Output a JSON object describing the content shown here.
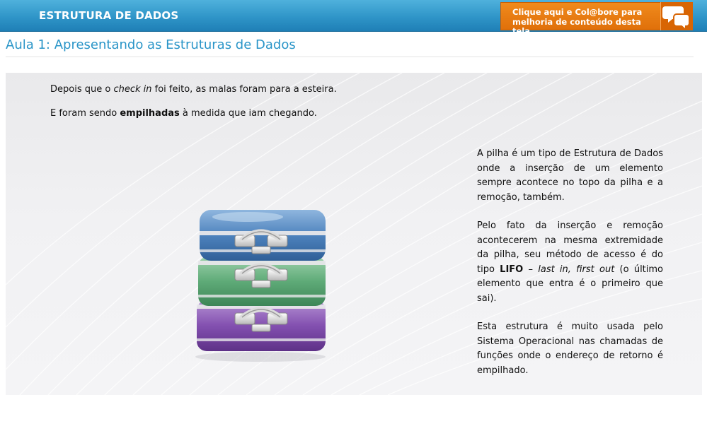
{
  "header": {
    "course_title": "ESTRUTURA DE DADOS",
    "collab_line1": "Clique aqui e Col@bore para",
    "collab_line2": "melhoria de conteúdo desta tela"
  },
  "lesson_title": "Aula 1: Apresentando as Estruturas de Dados",
  "intro": {
    "line1_a": "Depois que o ",
    "line1_em": "check in",
    "line1_b": " foi feito, as malas foram para a esteira.",
    "line2_a": "E foram sendo ",
    "line2_strong": "empilhadas",
    "line2_b": " à medida que iam chegando."
  },
  "paragraphs": {
    "p1": "A pilha é um tipo de Estrutura de Dados onde a inserção de um elemento sempre acontece no topo da pilha e a remoção, também.",
    "p2_a": "Pelo fato da inserção e remoção acontecerem na mesma extremidade da pilha, seu método de acesso é do tipo ",
    "p2_strong": "LIFO",
    "p2_dash": " – ",
    "p2_em": "last in, first out",
    "p2_b": " (o último elemento que entra é o primeiro que sai).",
    "p3": "Esta estrutura é muito usada pelo Sistema Operacional nas chamadas de funções onde o endereço de retorno é empilhado."
  },
  "colors": {
    "header_blue": "#2f95c8",
    "collab_orange": "#e87b12",
    "lesson_blue": "#2a95c8",
    "suitcase_top": "#4d82bd",
    "suitcase_middle": "#5fab78",
    "suitcase_bottom": "#8350b0"
  },
  "icons": {
    "collab": "chat-bubbles-icon",
    "image": "stacked-suitcases-illustration"
  }
}
